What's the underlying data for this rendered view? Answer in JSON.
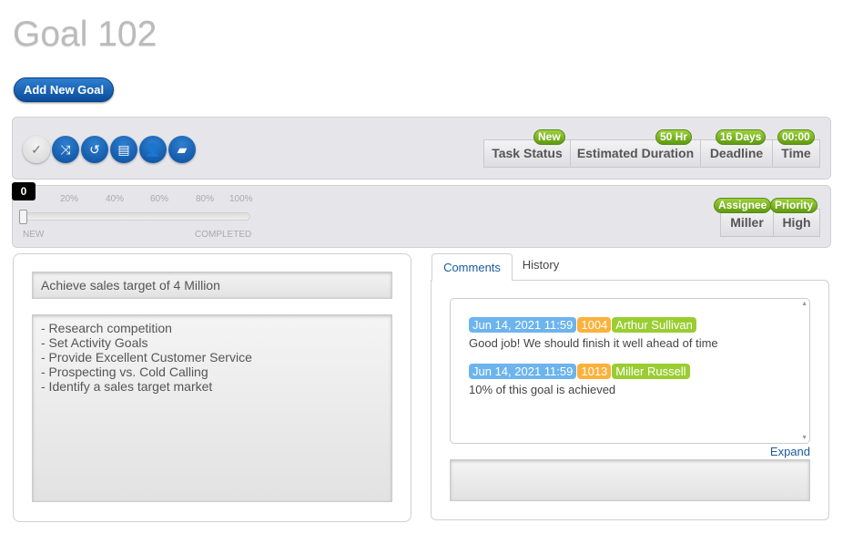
{
  "title": "Goal 102",
  "add_goal_label": "Add New Goal",
  "toolbar": {
    "icons": [
      "check-icon",
      "shuffle-icon",
      "history-icon",
      "archive-icon",
      "add-user-icon",
      "chat-icon"
    ],
    "buttons": [
      {
        "label": "Task Status",
        "badge": "New"
      },
      {
        "label": "Estimated Duration",
        "badge": "50 Hr"
      },
      {
        "label": "Deadline",
        "badge": "16 Days"
      },
      {
        "label": "Time",
        "badge": "00:00"
      }
    ]
  },
  "progress": {
    "value": 0,
    "value_label": "0",
    "ticks": [
      "20%",
      "40%",
      "60%",
      "80%",
      "100%"
    ],
    "start_label": "NEW",
    "end_label": "COMPLETED"
  },
  "assign": [
    {
      "label": "Miller",
      "badge": "Assignee"
    },
    {
      "label": "High",
      "badge": "Priority"
    }
  ],
  "goal": {
    "name": "Achieve sales target of 4 Million",
    "description": "- Research competition\n- Set Activity Goals\n- Provide Excellent Customer Service\n- Prospecting vs. Cold Calling\n- Identify a sales target market"
  },
  "tabs": [
    {
      "label": "Comments"
    },
    {
      "label": "History"
    }
  ],
  "comments": [
    {
      "date": "Jun 14, 2021 11:59",
      "id": "1004",
      "author": "Arthur Sullivan",
      "text": "Good job! We should finish it well ahead of time"
    },
    {
      "date": "Jun 14, 2021 11:59",
      "id": "1013",
      "author": "Miller Russell",
      "text": "10% of this goal is achieved"
    }
  ],
  "expand_label": "Expand",
  "comment_input": "",
  "colors": {
    "accent": "#0a4d9c",
    "badge_green": "#7ab51d",
    "date_blue": "#6cb4ee",
    "id_orange": "#fbb13c",
    "author_green": "#9acd32"
  }
}
